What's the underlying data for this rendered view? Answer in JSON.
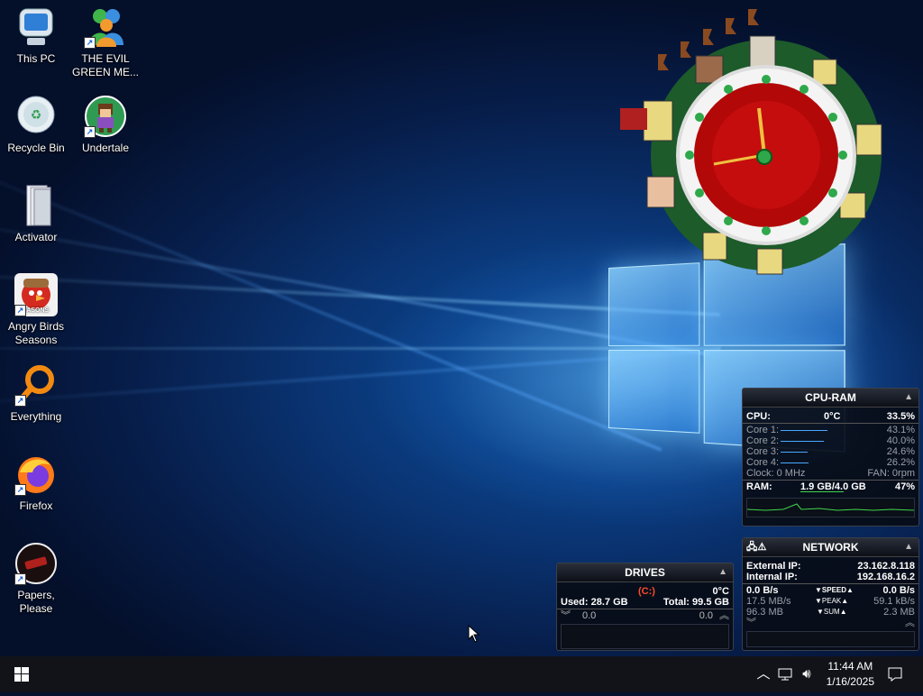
{
  "desktop_icons": [
    {
      "label": "This PC"
    },
    {
      "label": "THE EVIL\nGREEN ME..."
    },
    {
      "label": "Recycle Bin"
    },
    {
      "label": "Undertale"
    },
    {
      "label": "Activator"
    },
    {
      "label": "Angry Birds\nSeasons",
      "badge": "SEASONS"
    },
    {
      "label": "Everything"
    },
    {
      "label": "Firefox"
    },
    {
      "label": "Papers, Please"
    }
  ],
  "cpu_ram": {
    "title": "CPU-RAM",
    "cpu_label": "CPU:",
    "cpu_temp": "0°C",
    "cpu_pct": "33.5%",
    "cores": [
      {
        "label": "Core 1:",
        "value": "43.1%",
        "level": 0.431
      },
      {
        "label": "Core 2:",
        "value": "40.0%",
        "level": 0.4
      },
      {
        "label": "Core 3:",
        "value": "24.6%",
        "level": 0.246
      },
      {
        "label": "Core 4:",
        "value": "26.2%",
        "level": 0.262
      }
    ],
    "clock": "Clock: 0 MHz",
    "fan": "FAN: 0rpm",
    "ram_label": "RAM:",
    "ram_value": "1.9 GB/4.0 GB",
    "ram_pct": "47%"
  },
  "network": {
    "title": "NETWORK",
    "external_label": "External IP:",
    "external_ip": "23.162.8.118",
    "internal_label": "Internal IP:",
    "internal_ip": "192.168.16.2",
    "speed_down": "0.0 B/s",
    "speed_label": "SPEED",
    "speed_up": "0.0 B/s",
    "peak_down": "17.5 MB/s",
    "peak_label": "PEAK",
    "peak_up": "59.1 kB/s",
    "sum_down": "96.3 MB",
    "sum_label": "SUM",
    "sum_up": "2.3 MB"
  },
  "drives": {
    "title": "DRIVES",
    "drive_name": "(C:)",
    "temp": "0°C",
    "used": "Used: 28.7 GB",
    "total": "Total: 99.5 GB",
    "read": "0.0",
    "write": "0.0"
  },
  "taskbar": {
    "time": "11:44 AM",
    "date": "1/16/2025"
  },
  "colors": {
    "accent": "#4aa8ff",
    "ram_bar": "#3fd64a",
    "drive_name": "#ff4a2a"
  }
}
